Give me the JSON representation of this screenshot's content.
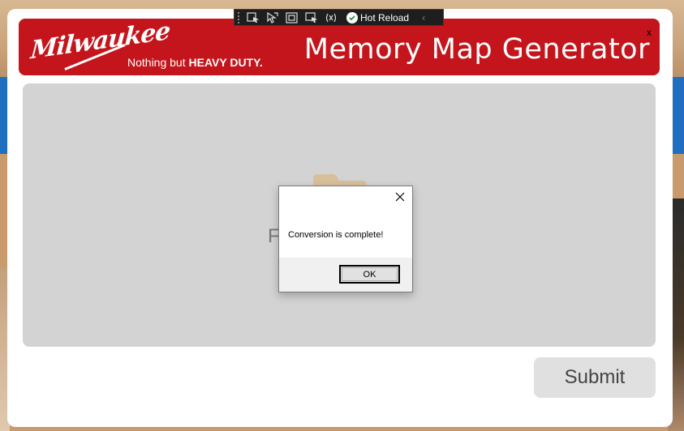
{
  "toolbar": {
    "hot_reload_label": "Hot Reload",
    "icons": [
      "select-element-icon",
      "pointer-icon",
      "layout-adorner-icon",
      "track-focus-icon",
      "binding-failures-icon",
      "hot-reload-check-icon",
      "collapse-chevron-icon"
    ]
  },
  "banner": {
    "logo_text": "Milwaukee",
    "tagline_prefix": "Nothing but ",
    "tagline_bold": "HEAVY DUTY.",
    "title": "Memory Map Generator",
    "close_label": "x",
    "color": "#c4151c"
  },
  "drop_area": {
    "partial_text": "F",
    "icon": "folder-icon"
  },
  "submit": {
    "label": "Submit"
  },
  "dialog": {
    "message": "Conversion is complete!",
    "ok_label": "OK"
  }
}
